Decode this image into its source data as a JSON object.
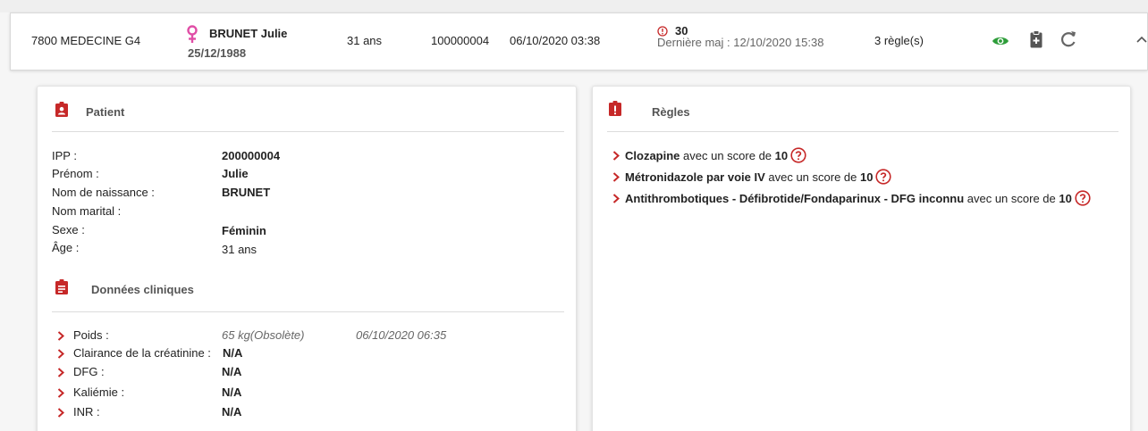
{
  "header": {
    "unit": "7800  MEDECINE G4",
    "patient_name": "BRUNET Julie",
    "dob": "25/12/1988",
    "age": "31 ans",
    "ipp": "100000004",
    "admission": "06/10/2020 03:38",
    "score": "30",
    "last_update": "Dernière maj : 12/10/2020 15:38",
    "rules_count": "3 règle(s)"
  },
  "patient": {
    "title": "Patient",
    "fields": [
      {
        "label": "IPP :",
        "value": "200000004",
        "bold": true
      },
      {
        "label": "Prénom :",
        "value": "Julie",
        "bold": true
      },
      {
        "label": "Nom de naissance :",
        "value": "BRUNET",
        "bold": true
      },
      {
        "label": "Nom marital :",
        "value": "",
        "bold": false
      },
      {
        "label": "Sexe :",
        "value": "Féminin",
        "bold": true
      },
      {
        "label": "Âge :",
        "value": "31 ans",
        "bold": false
      }
    ]
  },
  "clinical": {
    "title": "Données cliniques",
    "rows": [
      {
        "label": "Poids :",
        "value": "65 kg(Obsolète)",
        "date": "06/10/2020 06:35"
      },
      {
        "label": "Clairance de la créatinine :",
        "value": "N/A",
        "date": ""
      },
      {
        "label": "DFG :",
        "value": "N/A",
        "date": ""
      },
      {
        "label": "Kaliémie :",
        "value": "N/A",
        "date": ""
      },
      {
        "label": "INR :",
        "value": "N/A",
        "date": ""
      }
    ]
  },
  "rules": {
    "title": "Règles",
    "items": [
      {
        "name": "Clozapine",
        "text": " avec un score de ",
        "score": "10"
      },
      {
        "name": "Métronidazole par voie IV",
        "text": " avec un score de ",
        "score": "10"
      },
      {
        "name": "Antithrombotiques - Défibrotide/Fondaparinux - DFG inconnu",
        "text": " avec un score de ",
        "score": "10"
      }
    ]
  },
  "colors": {
    "accent_red": "#c62828",
    "gender_pink": "#e04ea6",
    "eye_green": "#2e9d3a"
  }
}
